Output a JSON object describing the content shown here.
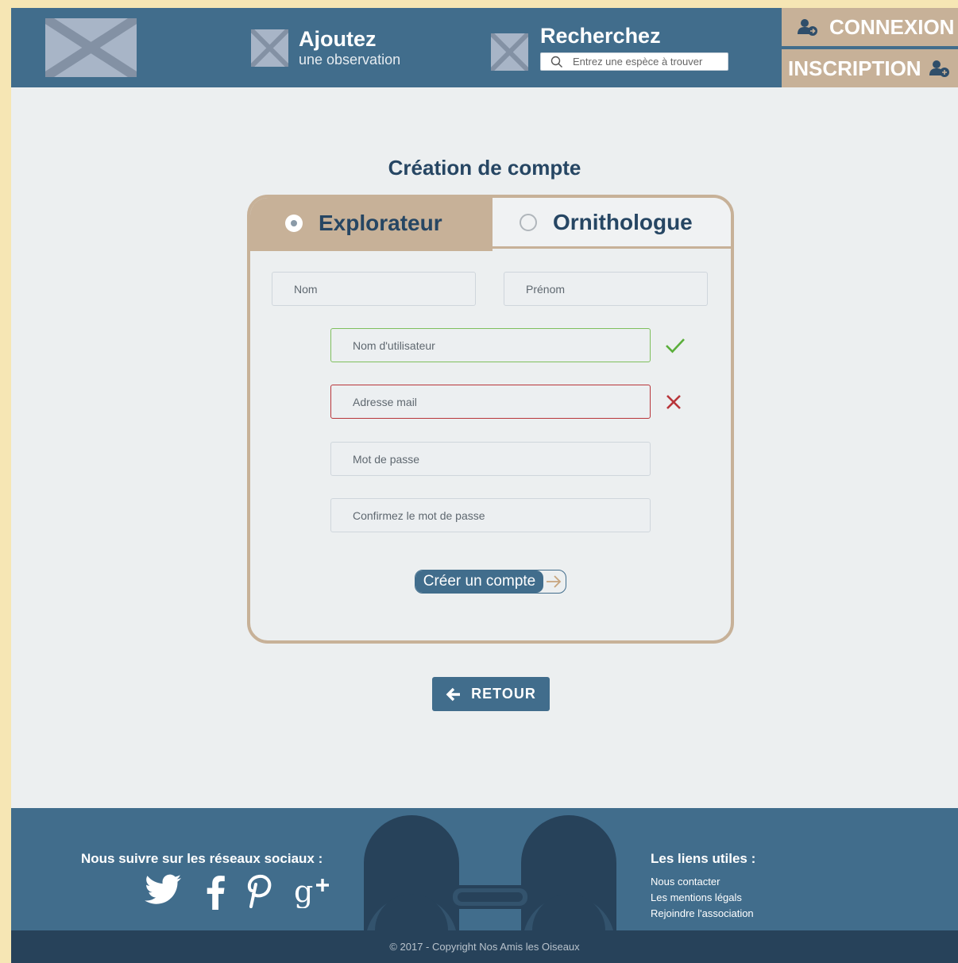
{
  "header": {
    "add_title": "Ajoutez",
    "add_subtitle": "une observation",
    "search_title": "Recherchez",
    "search_placeholder": "Entrez une espèce à trouver",
    "connexion_label": "CONNEXION",
    "inscription_label": "INSCRIPTION"
  },
  "main": {
    "title": "Création de compte",
    "tabs": [
      {
        "label": "Explorateur",
        "selected": true
      },
      {
        "label": "Ornithologue",
        "selected": false
      }
    ],
    "fields": {
      "nom_placeholder": "Nom",
      "prenom_placeholder": "Prénom",
      "username_placeholder": "Nom d'utilisateur",
      "email_placeholder": "Adresse mail",
      "password_placeholder": "Mot de passe",
      "confirm_placeholder": "Confirmez le mot de passe"
    },
    "validation": {
      "username_status": "valid",
      "email_status": "invalid"
    },
    "submit_label": "Créer un compte",
    "back_label": "RETOUR"
  },
  "footer": {
    "social_title": "Nous suivre sur les réseaux sociaux :",
    "social_icons": [
      "twitter-icon",
      "facebook-icon",
      "pinterest-icon",
      "google-plus-icon"
    ],
    "links_title": "Les liens utiles :",
    "links": [
      "Nous contacter",
      "Les mentions légals",
      "Rejoindre l'association"
    ],
    "copyright": "© 2017 - Copyright Nos Amis les Oiseaux"
  },
  "colors": {
    "primary": "#416d8c",
    "accent": "#c7b198",
    "dark": "#27425a",
    "title": "#264663",
    "valid": "#5aae3a",
    "error": "#b8353a",
    "background": "#eceff0"
  }
}
